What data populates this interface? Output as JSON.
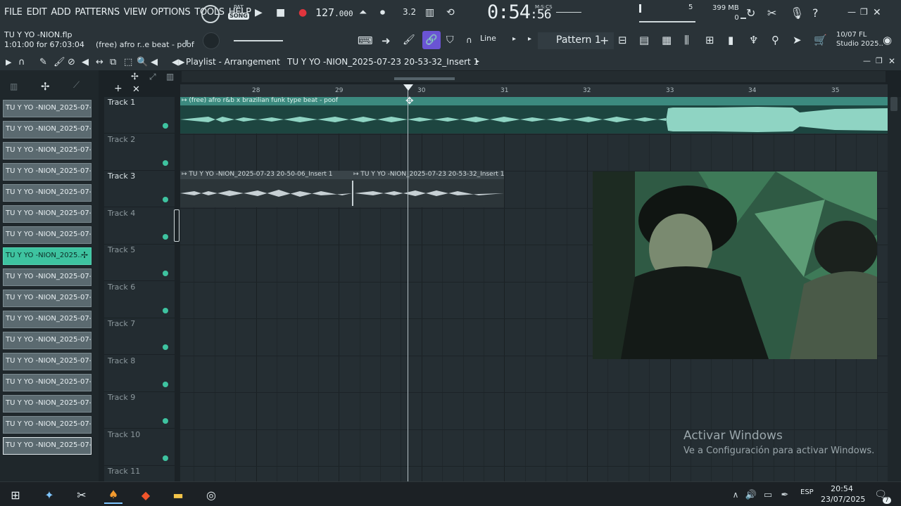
{
  "menu": [
    "FILE",
    "EDIT",
    "ADD",
    "PATTERNS",
    "VIEW",
    "OPTIONS",
    "TOOLS",
    "HELP"
  ],
  "transport": {
    "pat": "PAT",
    "song": "SONG",
    "bpm_main": "127",
    "bpm_frac": ".000"
  },
  "clock": {
    "main": "0:54",
    "sub": ":56",
    "unit": "M:S:CS"
  },
  "monitor": {
    "cpu": "5",
    "mem": "399 MB",
    "poly": "0"
  },
  "project": {
    "file": "TU Y YO -NION.flp",
    "position": "1:01:00 for 67:03:04",
    "hint": "(free) afro r..e beat - poof"
  },
  "toolbar": {
    "snap": "Line",
    "pattern": "Pattern 1",
    "date": "10/07",
    "brand": "FL",
    "studio": "Studio 2025.."
  },
  "playlist": {
    "title": "Playlist - Arrangement",
    "crumb": "TU Y YO -NION_2025-07-23 20-53-32_Insert 1"
  },
  "ruler": [
    "28",
    "29",
    "30",
    "31",
    "32",
    "33",
    "34",
    "35"
  ],
  "browser_clips": [
    "TU Y YO -NION_2025-07-..",
    "TU Y YO -NION_2025-07-..",
    "TU Y YO -NION_2025-07-..",
    "TU Y YO -NION_2025-07-..",
    "TU Y YO -NION_2025-07-..",
    "TU Y YO -NION_2025-07-..",
    "TU Y YO -NION_2025-07-..",
    "TU Y YO -NION_2025..",
    "TU Y YO -NION_2025-07-..",
    "TU Y YO -NION_2025-07-..",
    "TU Y YO -NION_2025-07-..",
    "TU Y YO -NION_2025-07-..",
    "TU Y YO -NION_2025-07-..",
    "TU Y YO -NION_2025-07-..",
    "TU Y YO -NION_2025-07-..",
    "TU Y YO -NION_2025-07-..",
    "TU Y YO -NION_2025-07-.."
  ],
  "tracks": [
    "Track 1",
    "Track 2",
    "Track 3",
    "Track 4",
    "Track 5",
    "Track 6",
    "Track 7",
    "Track 8",
    "Track 9",
    "Track 10",
    "Track 11"
  ],
  "clips": {
    "beat": "(free) afro r&b x brazilian funk type beat - poof",
    "insert_a": "TU Y YO -NION_2025-07-23 20-50-06_Insert 1",
    "insert_b": "TU Y YO -NION_2025-07-23 20-53-32_Insert 1"
  },
  "watermark": {
    "line1": "Activar Windows",
    "line2": "Ve a Configuración para activar Windows."
  },
  "taskbar": {
    "lang": "ESP",
    "time": "20:54",
    "date": "23/07/2025",
    "notif": "7"
  },
  "colors": {
    "accent": "#3ec3a0",
    "link": "#6a54d4",
    "record": "#e0353d"
  }
}
